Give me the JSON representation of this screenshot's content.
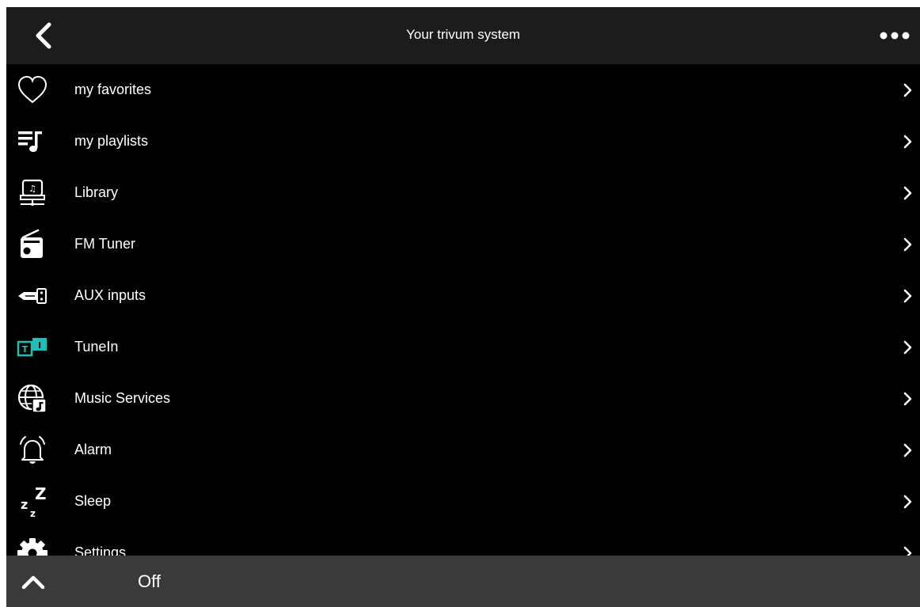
{
  "header": {
    "title": "Your trivum system",
    "back_icon": "chevron-left-icon",
    "more_icon": "more-horizontal-icon"
  },
  "menu": {
    "items": [
      {
        "label": "my favorites",
        "icon": "heart-icon"
      },
      {
        "label": "my playlists",
        "icon": "playlist-icon"
      },
      {
        "label": "Library",
        "icon": "library-icon"
      },
      {
        "label": "FM Tuner",
        "icon": "radio-icon"
      },
      {
        "label": "AUX inputs",
        "icon": "aux-input-icon"
      },
      {
        "label": "TuneIn",
        "icon": "tunein-icon"
      },
      {
        "label": "Music Services",
        "icon": "music-services-icon"
      },
      {
        "label": "Alarm",
        "icon": "bell-icon"
      },
      {
        "label": "Sleep",
        "icon": "sleep-icon"
      },
      {
        "label": "Settings",
        "icon": "gear-icon"
      }
    ]
  },
  "footer": {
    "status": "Off",
    "expand_icon": "chevron-up-icon"
  },
  "colors": {
    "background": "#000000",
    "header_bg": "#1c1c1c",
    "footer_bg": "#3a3a3a",
    "text": "#ffffff",
    "tunein_accent": "#1cc0b8"
  }
}
